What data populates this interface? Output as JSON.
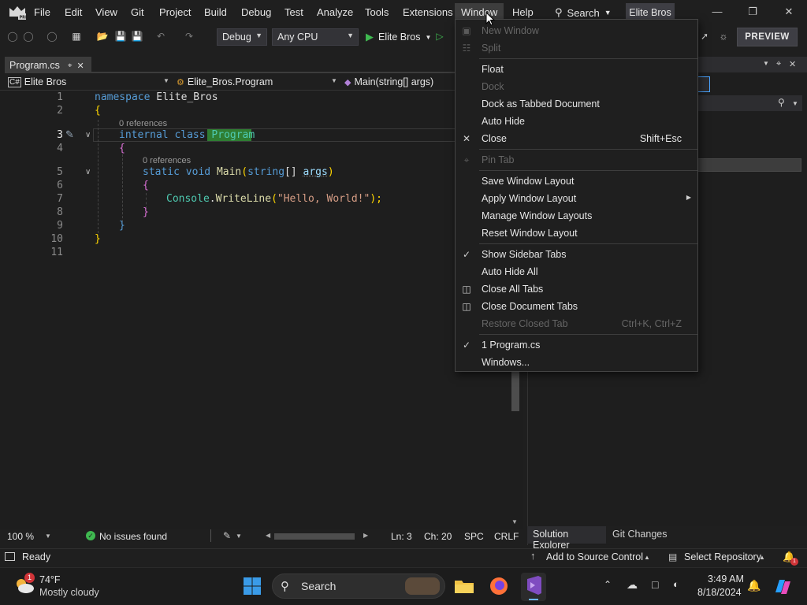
{
  "menubar": {
    "items": [
      "File",
      "Edit",
      "View",
      "Git",
      "Project",
      "Build",
      "Debug",
      "Test",
      "Analyze",
      "Tools",
      "Extensions",
      "Window",
      "Help"
    ],
    "search_label": "Search",
    "solution_name": "Elite Bros"
  },
  "toolbar": {
    "configuration": "Debug",
    "platform": "Any CPU",
    "run_target": "Elite Bros",
    "preview_label": "PREVIEW"
  },
  "editor": {
    "tab_name": "Program.cs",
    "nav_project": "Elite Bros",
    "nav_class": "Elite_Bros.Program",
    "nav_member": "Main(string[] args)",
    "line_numbers": [
      "1",
      "2",
      "3",
      "4",
      "5",
      "6",
      "7",
      "8",
      "9",
      "10",
      "11"
    ],
    "code": {
      "l1_kw": "namespace",
      "l1_name": "Elite_Bros",
      "l2": "{",
      "lens_class": "0 references",
      "l3_kw1": "internal",
      "l3_kw2": "class",
      "l3_name": "Program",
      "l4": "{",
      "lens_method": "0 references",
      "l5_kw1": "static",
      "l5_kw2": "void",
      "l5_fn": "Main",
      "l5_open": "(",
      "l5_type": "string",
      "l5_arr": "[]",
      "l5_param": "args",
      "l5_close": ")",
      "l6": "{",
      "l7_obj": "Console",
      "l7_dot": ".",
      "l7_fn": "WriteLine",
      "l7_open": "(",
      "l7_str": "\"Hello, World!\"",
      "l7_close": ");",
      "l8": "}",
      "l9": "}",
      "l10": "}"
    },
    "zoom": "100 %",
    "issues": "No issues found",
    "line": "Ln: 3",
    "col": "Ch: 20",
    "whitespace": "SPC",
    "line_ending": "CRLF"
  },
  "right_panel": {
    "tabs": [
      "Solution Explorer",
      "Git Changes"
    ]
  },
  "statusbar": {
    "ready": "Ready",
    "add_source_control": "Add to Source Control",
    "select_repo": "Select Repository"
  },
  "taskbar": {
    "temperature": "74°F",
    "weather": "Mostly cloudy",
    "search": "Search",
    "time": "3:49 AM",
    "date": "8/18/2024",
    "weather_badge": "1"
  },
  "window_menu": {
    "items": [
      {
        "label": "New Window",
        "disabled": true
      },
      {
        "label": "Split",
        "disabled": true
      },
      {
        "label": "Float"
      },
      {
        "label": "Dock",
        "disabled": true
      },
      {
        "label": "Dock as Tabbed Document"
      },
      {
        "label": "Auto Hide"
      },
      {
        "label": "Close",
        "shortcut": "Shift+Esc"
      },
      {
        "label": "Pin Tab",
        "disabled": true
      },
      {
        "label": "Save Window Layout"
      },
      {
        "label": "Apply Window Layout"
      },
      {
        "label": "Manage Window Layouts"
      },
      {
        "label": "Reset Window Layout"
      },
      {
        "label": "Show Sidebar Tabs",
        "checked": true
      },
      {
        "label": "Auto Hide All"
      },
      {
        "label": "Close All Tabs"
      },
      {
        "label": "Close Document Tabs"
      },
      {
        "label": "Restore Closed Tab",
        "shortcut": "Ctrl+K, Ctrl+Z",
        "disabled": true
      },
      {
        "label": "1 Program.cs",
        "checked": true
      },
      {
        "label": "Windows..."
      }
    ]
  },
  "colors": {
    "accent_green": "#2f7d32",
    "keyword_blue": "#569cd6",
    "type_teal": "#4ec9b0",
    "vs_purple": "#7f4cc0"
  }
}
